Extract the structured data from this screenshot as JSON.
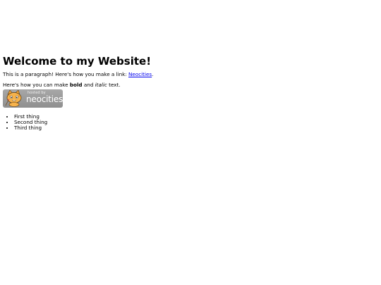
{
  "page": {
    "heading": "Welcome to my Website!",
    "paragraph1": {
      "before": "This is a paragraph! Here's how you make a link: ",
      "link_text": "Neocities",
      "after": "."
    },
    "paragraph2": {
      "before": "Here's how you can make ",
      "bold": "bold",
      "middle": " and ",
      "italic": "italic",
      "after": " text."
    },
    "badge": {
      "line1": "hosted by",
      "line2": "neocities",
      "icon": "neocities-cat-logo-icon"
    },
    "list_items": [
      "First thing",
      "Second thing",
      "Third thing"
    ]
  },
  "colors": {
    "link": "#0000ee",
    "badge_background": "#9a9a9a",
    "cat_orange": "#f3a43a"
  }
}
